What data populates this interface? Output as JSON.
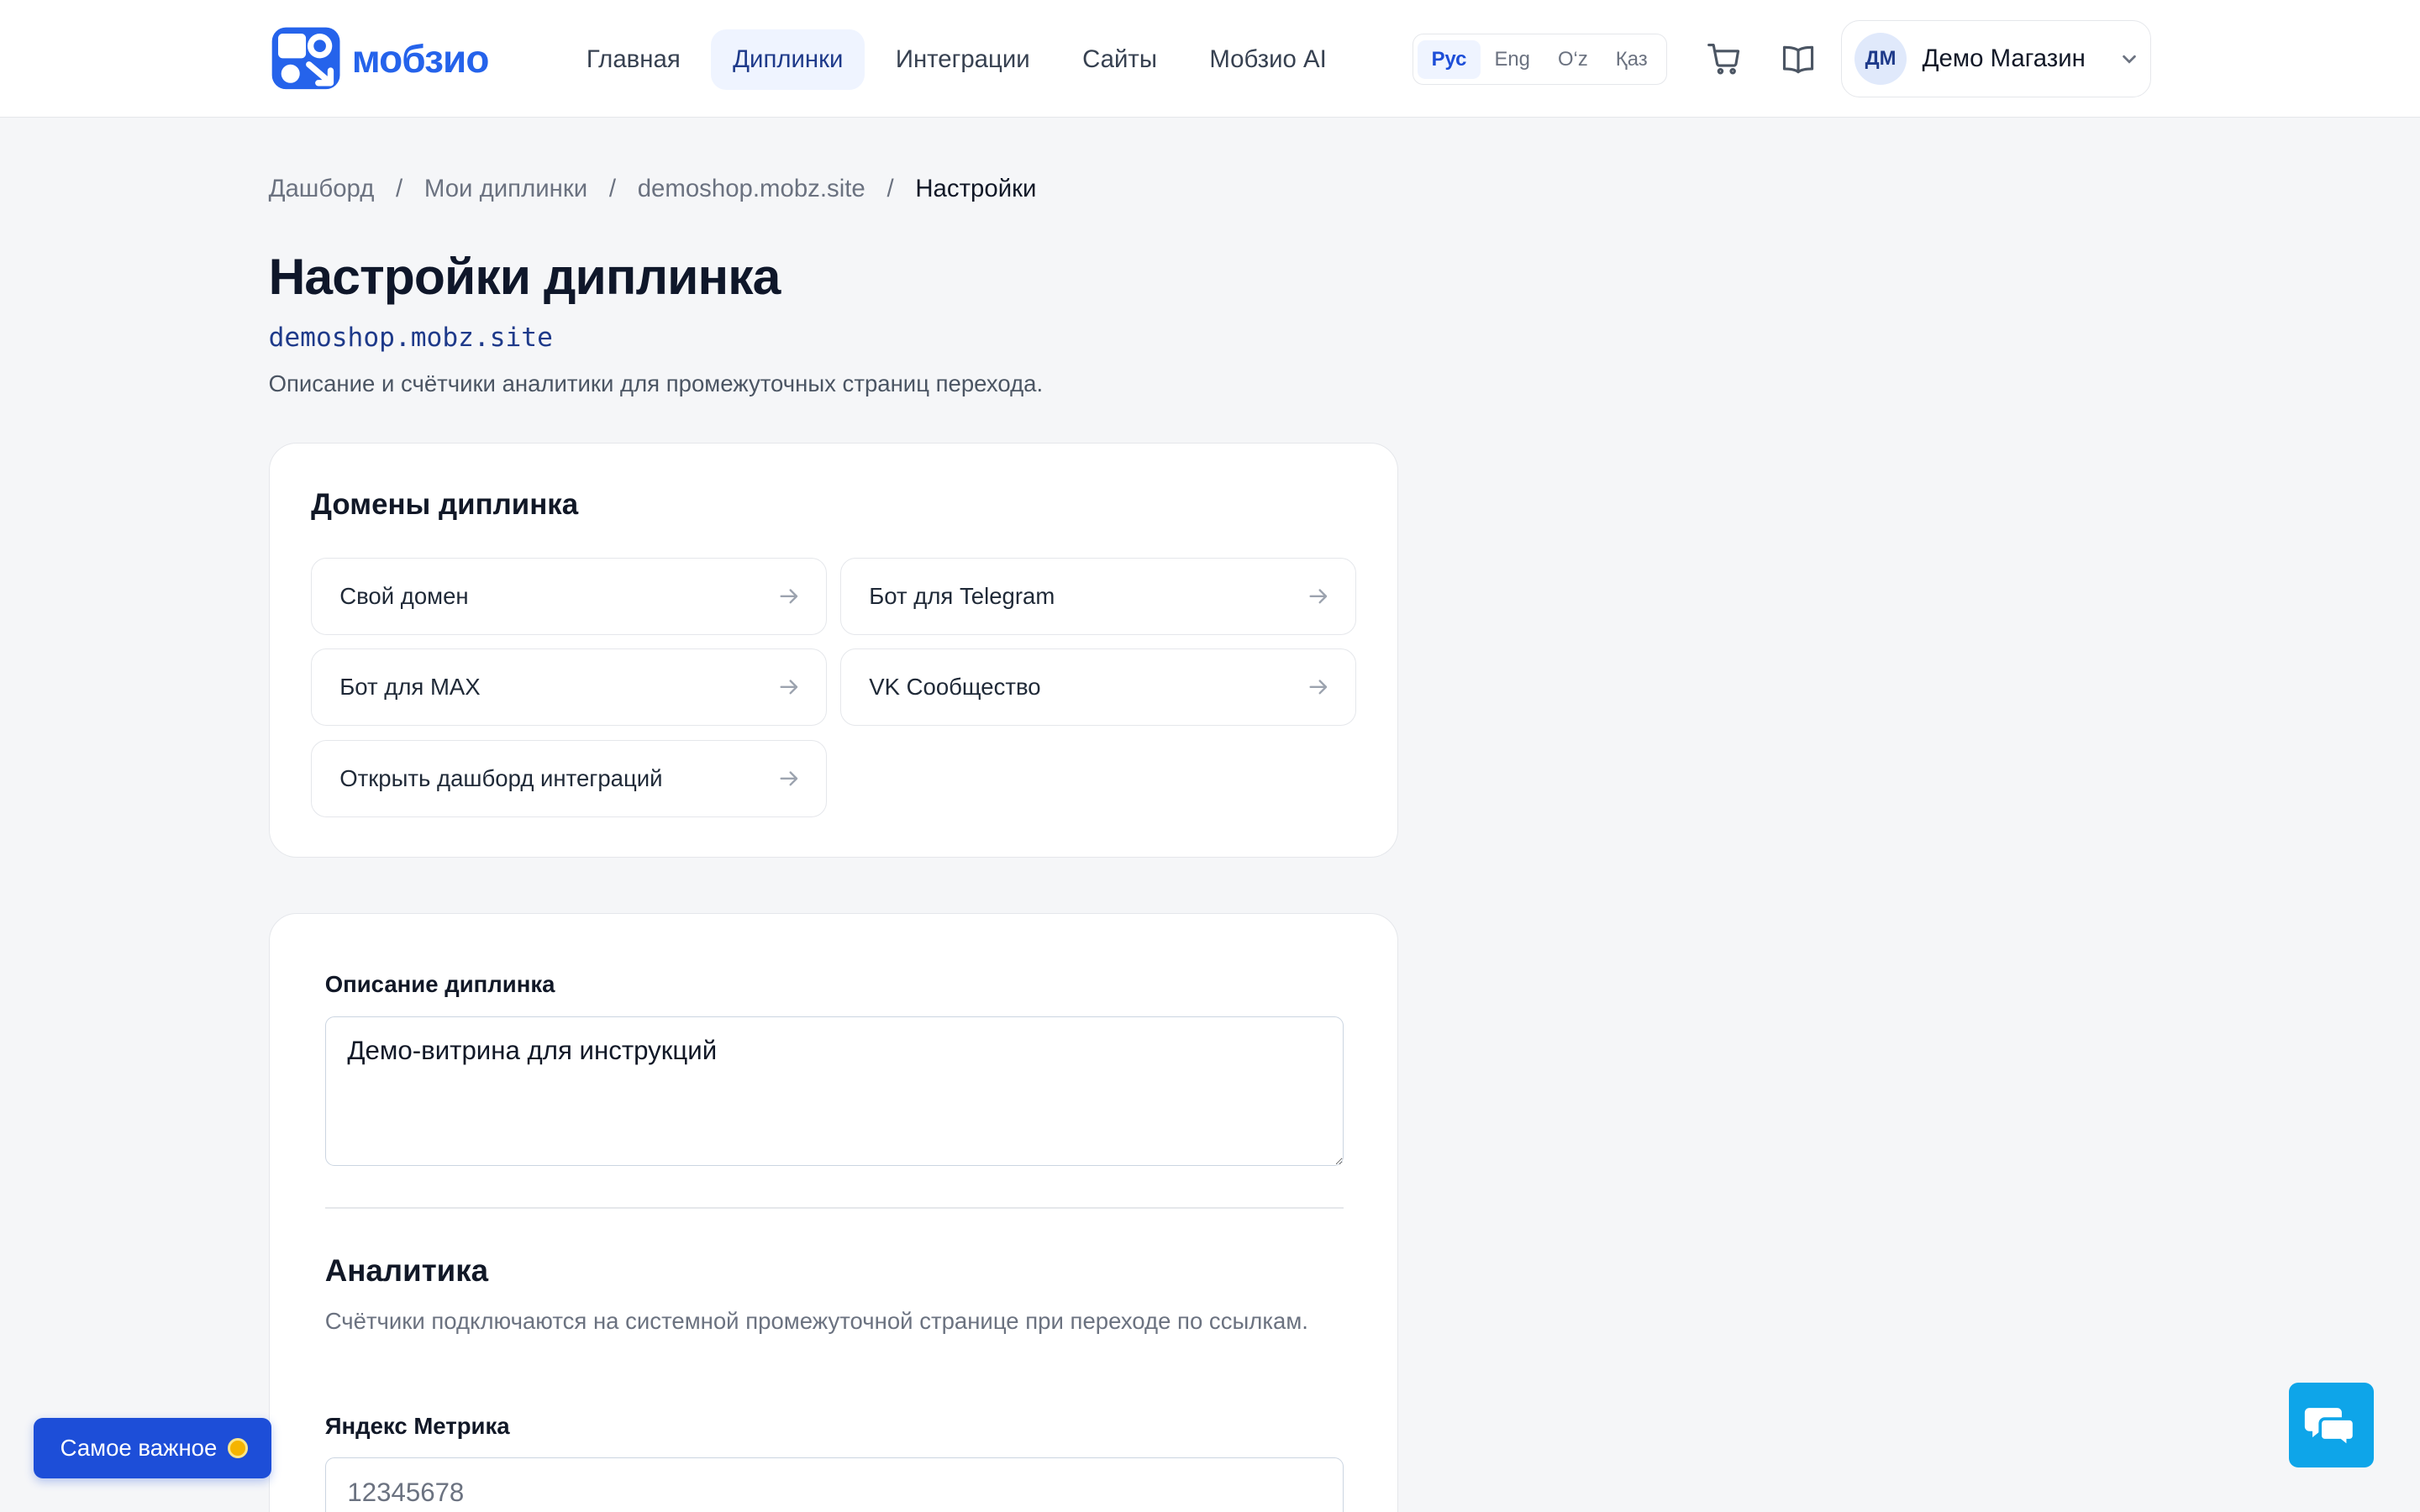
{
  "header": {
    "logo_text": "мобзио",
    "nav": [
      {
        "label": "Главная",
        "active": false
      },
      {
        "label": "Диплинки",
        "active": true
      },
      {
        "label": "Интеграции",
        "active": false
      },
      {
        "label": "Сайты",
        "active": false
      },
      {
        "label": "Мобзио AI",
        "active": false
      }
    ],
    "languages": [
      {
        "label": "Рус",
        "active": true
      },
      {
        "label": "Eng",
        "active": false
      },
      {
        "label": "O‘z",
        "active": false
      },
      {
        "label": "Қаз",
        "active": false
      }
    ],
    "icons": [
      "cart-icon",
      "book-icon"
    ],
    "user": {
      "initials": "ДМ",
      "name": "Демо Магазин"
    }
  },
  "breadcrumb": {
    "items": [
      "Дашборд",
      "Мои диплинки",
      "demoshop.mobz.site",
      "Настройки"
    ],
    "separator": "/"
  },
  "page": {
    "title": "Настройки диплинка",
    "domain": "demoshop.mobz.site",
    "subtitle": "Описание и счётчики аналитики для промежуточных страниц перехода."
  },
  "domains_card": {
    "title": "Домены диплинка",
    "links": [
      "Свой домен",
      "Бот для Telegram",
      "Бот для MAX",
      "VK Сообщество",
      "Открыть дашборд интеграций"
    ]
  },
  "settings_card": {
    "description_label": "Описание диплинка",
    "description_value": "Демо-витрина для инструкций",
    "analytics_title": "Аналитика",
    "analytics_desc": "Счётчики подключаются на системной промежуточной странице при переходе по ссылкам.",
    "yandex_label": "Яндекс Метрика",
    "yandex_placeholder": "12345678"
  },
  "floating": {
    "important_label": "Самое важное",
    "chat_icon": "chat-icon"
  },
  "colors": {
    "brand": "#2563eb",
    "accent_dark": "#1d4ed8",
    "chat": "#0ea5e9",
    "badge_dot": "#f5b400"
  }
}
